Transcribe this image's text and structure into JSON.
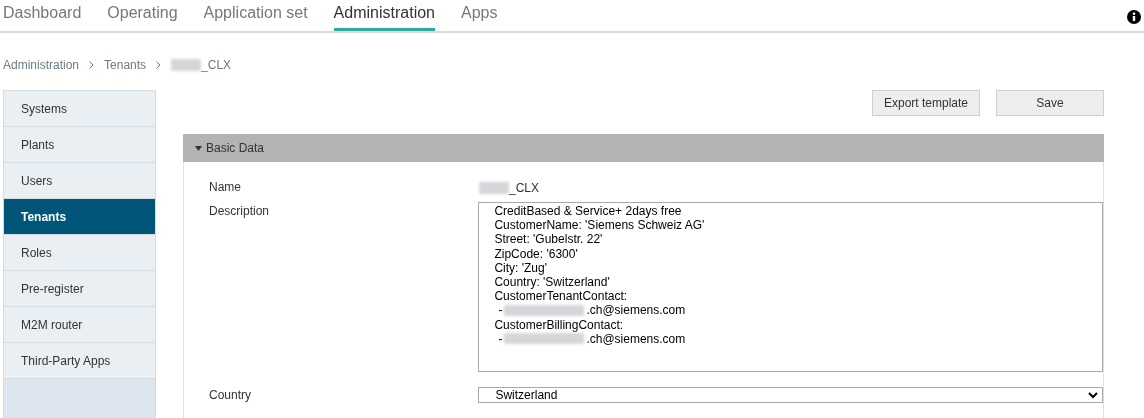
{
  "nav": {
    "tabs": [
      {
        "label": "Dashboard",
        "selected": false
      },
      {
        "label": "Operating",
        "selected": false
      },
      {
        "label": "Application set",
        "selected": false
      },
      {
        "label": "Administration",
        "selected": true
      },
      {
        "label": "Apps",
        "selected": false
      }
    ]
  },
  "breadcrumb": [
    {
      "kind": "link",
      "text": "Administration"
    },
    {
      "kind": "link",
      "text": "Tenants"
    },
    {
      "kind": "redacted",
      "text": "_CLX"
    }
  ],
  "sidebar": {
    "items": [
      {
        "label": "Systems",
        "selected": false
      },
      {
        "label": "Plants",
        "selected": false
      },
      {
        "label": "Users",
        "selected": false
      },
      {
        "label": "Tenants",
        "selected": true
      },
      {
        "label": "Roles",
        "selected": false
      },
      {
        "label": "Pre-register",
        "selected": false
      },
      {
        "label": "M2M router",
        "selected": false
      },
      {
        "label": "Third-Party Apps",
        "selected": false
      }
    ]
  },
  "buttons": [
    "Export template",
    "Save"
  ],
  "panel": {
    "title": "Basic Data",
    "expanded": true,
    "name": {
      "label": "Name",
      "value": "_CLX"
    },
    "description": {
      "label": "Description",
      "lines": [
        {
          "kind": "text",
          "text": "CreditBased & Service+ 2days free"
        },
        {
          "kind": "text",
          "text": "CustomerName: 'Siemens Schweiz AG'"
        },
        {
          "kind": "text",
          "text": "Street: 'Gubelstr. 22'"
        },
        {
          "kind": "text",
          "text": "ZipCode: '6300'"
        },
        {
          "kind": "text",
          "text": "City: 'Zug'"
        },
        {
          "kind": "text",
          "text": "Country: 'Switzerland'"
        },
        {
          "kind": "text",
          "text": "CustomerTenantContact:"
        },
        {
          "kind": "redacted",
          "prefix": "-",
          "text": ".ch@siemens.com"
        },
        {
          "kind": "text",
          "text": "CustomerBillingContact:"
        },
        {
          "kind": "redacted",
          "prefix": "-",
          "text": ".ch@siemens.com"
        }
      ]
    },
    "country": {
      "label": "Country",
      "value": "Switzerland"
    }
  }
}
